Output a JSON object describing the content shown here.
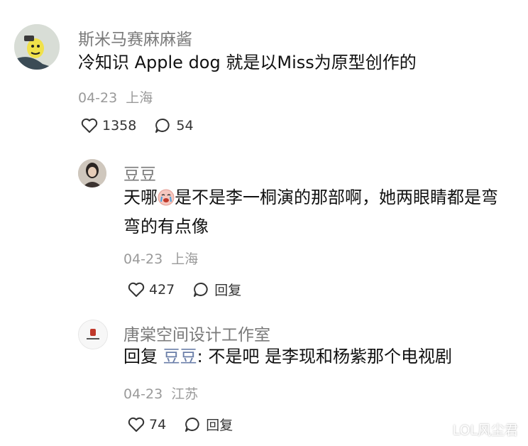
{
  "comments": [
    {
      "username": "斯米马赛麻麻酱",
      "text": "冷知识 Apple dog 就是以Miss为原型创作的",
      "date": "04-23",
      "location": "上海",
      "likes": "1358",
      "replies": "54",
      "avatar_icon": "cartoon-avatar"
    }
  ],
  "replies": [
    {
      "username": "豆豆",
      "text_before_emoji": "天哪",
      "emoji": "crying-face-emoji",
      "text_after_emoji": "是不是李一桐演的那部啊，她两眼睛都是弯弯的有点像",
      "date": "04-23",
      "location": "上海",
      "likes": "427",
      "reply_label": "回复"
    },
    {
      "username": "唐棠空间设计工作室",
      "reply_prefix": "回复",
      "mention": "豆豆",
      "text": ": 不是吧 是李现和杨紫那个电视剧",
      "date": "04-23",
      "location": "江苏",
      "likes": "74",
      "reply_label": "回复"
    }
  ],
  "watermark": "LOL风尘君",
  "colors": {
    "username": "#7a7a7a",
    "meta": "#9a9a9a",
    "mention": "#6a7ea8"
  }
}
